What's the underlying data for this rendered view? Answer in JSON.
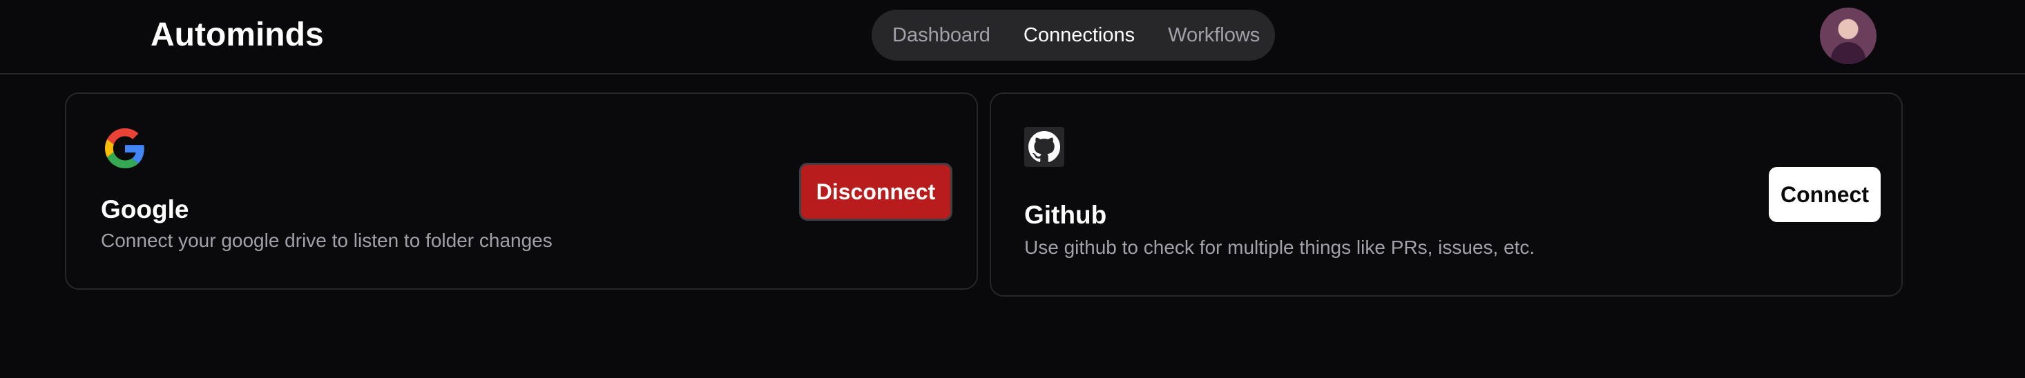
{
  "header": {
    "brand": "Autominds",
    "nav": [
      {
        "label": "Dashboard",
        "active": false
      },
      {
        "label": "Connections",
        "active": true
      },
      {
        "label": "Workflows",
        "active": false
      }
    ]
  },
  "connections": [
    {
      "icon": "google-icon",
      "title": "Google",
      "description": "Connect your google drive to listen to folder changes",
      "action_label": "Disconnect",
      "connected": true
    },
    {
      "icon": "github-icon",
      "title": "Github",
      "description": "Use github to check for multiple things like PRs, issues, etc.",
      "action_label": "Connect",
      "connected": false
    }
  ],
  "colors": {
    "background": "#09090b",
    "border": "#27272a",
    "disconnect": "#b91c1c",
    "muted_text": "#a1a1aa"
  }
}
